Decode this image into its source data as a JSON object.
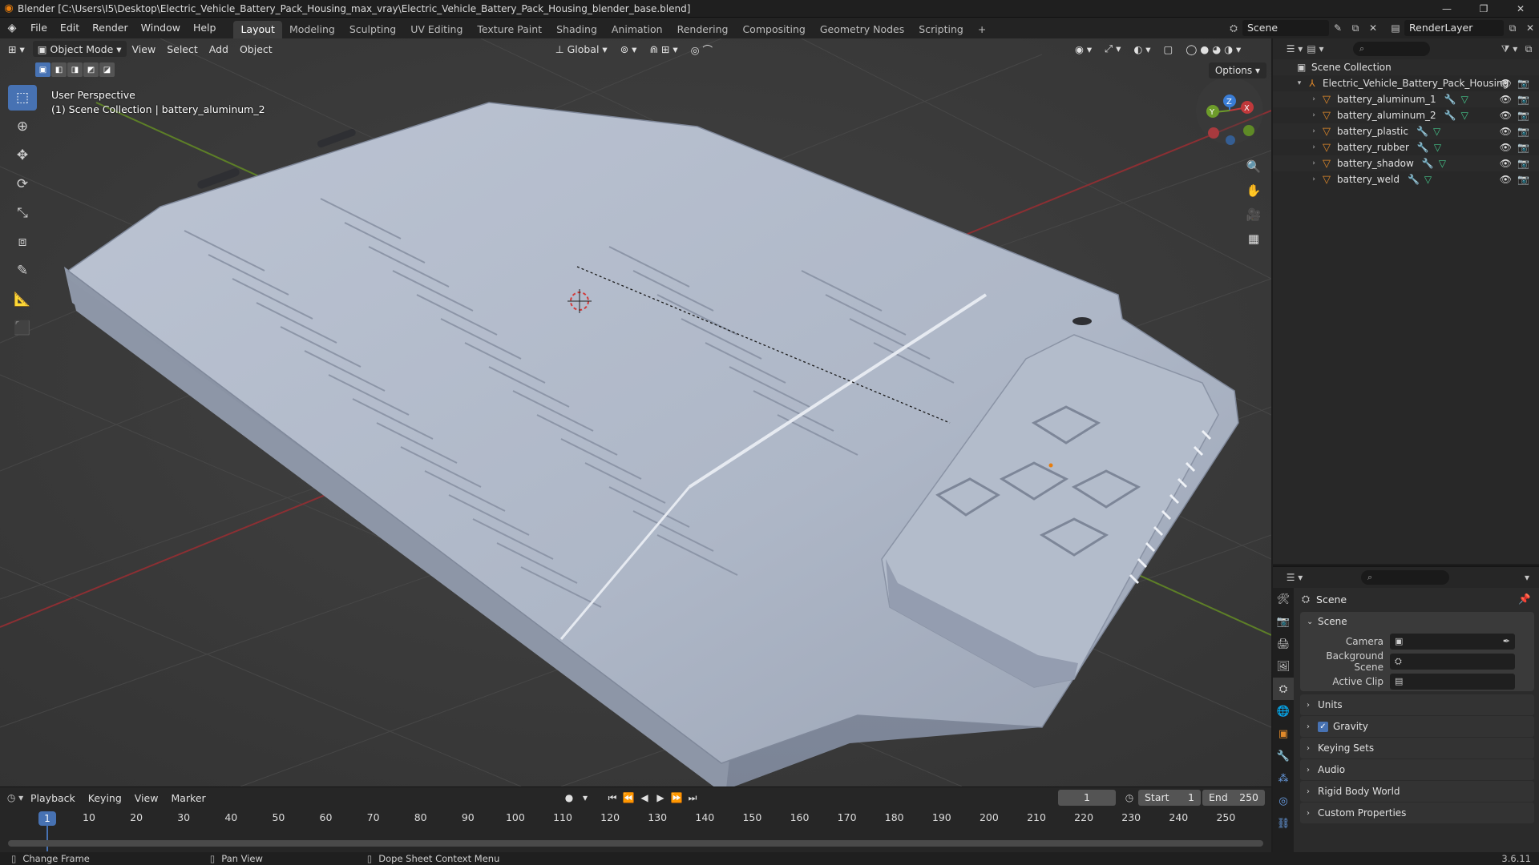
{
  "window": {
    "title": "Blender [C:\\Users\\I5\\Desktop\\Electric_Vehicle_Battery_Pack_Housing_max_vray\\Electric_Vehicle_Battery_Pack_Housing_blender_base.blend]"
  },
  "menu": [
    "File",
    "Edit",
    "Render",
    "Window",
    "Help"
  ],
  "workspaces": [
    "Layout",
    "Modeling",
    "Sculpting",
    "UV Editing",
    "Texture Paint",
    "Shading",
    "Animation",
    "Rendering",
    "Compositing",
    "Geometry Nodes",
    "Scripting"
  ],
  "active_workspace": "Layout",
  "scene_name": "Scene",
  "view_layer": "RenderLayer",
  "viewport": {
    "mode": "Object Mode",
    "menus": [
      "View",
      "Select",
      "Add",
      "Object"
    ],
    "orientation": "Global",
    "options_label": "Options",
    "perspective_label": "User Perspective",
    "collection_label": "(1) Scene Collection | battery_aluminum_2"
  },
  "outliner": {
    "root": "Scene Collection",
    "collection": "Electric_Vehicle_Battery_Pack_Housing",
    "objects": [
      "battery_aluminum_1",
      "battery_aluminum_2",
      "battery_plastic",
      "battery_rubber",
      "battery_shadow",
      "battery_weld"
    ]
  },
  "properties": {
    "context": "Scene",
    "panel": "Scene",
    "fields": [
      {
        "label": "Camera",
        "value": ""
      },
      {
        "label": "Background Scene",
        "value": ""
      },
      {
        "label": "Active Clip",
        "value": ""
      }
    ],
    "sections": [
      "Units",
      "Gravity",
      "Keying Sets",
      "Audio",
      "Rigid Body World",
      "Custom Properties"
    ],
    "gravity_checked": true
  },
  "timeline": {
    "menus": [
      "Playback",
      "Keying",
      "View",
      "Marker"
    ],
    "current_frame": "1",
    "start_label": "Start",
    "start": "1",
    "end_label": "End",
    "end": "250",
    "ticks": [
      "10",
      "20",
      "30",
      "40",
      "50",
      "60",
      "70",
      "80",
      "90",
      "100",
      "110",
      "120",
      "130",
      "140",
      "150",
      "160",
      "170",
      "180",
      "190",
      "200",
      "210",
      "220",
      "230",
      "240",
      "250"
    ],
    "playhead_label": "1"
  },
  "statusbar": {
    "hints": [
      "Change Frame",
      "Pan View",
      "Dope Sheet Context Menu"
    ],
    "version": "3.6.11"
  },
  "colors": {
    "accent": "#4772b3",
    "object_orange": "#e0892a",
    "x_axis": "#c0393b",
    "y_axis": "#6d9c2a",
    "z_axis": "#3a7dd6"
  }
}
